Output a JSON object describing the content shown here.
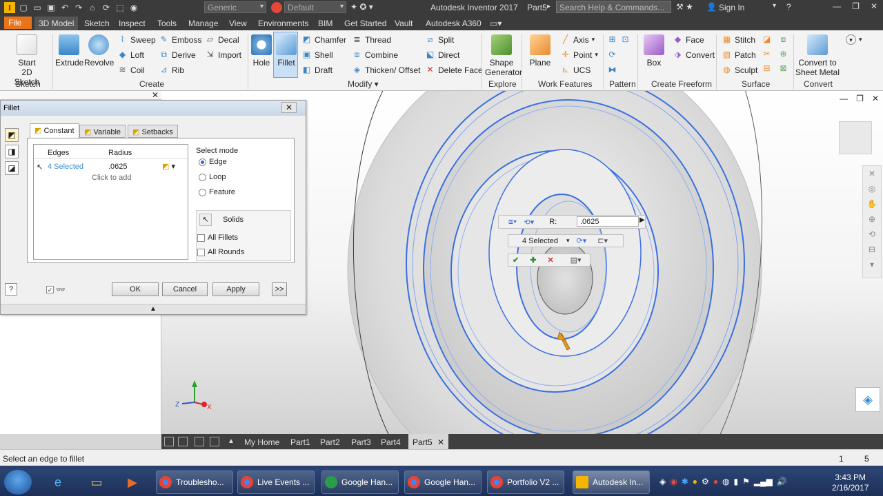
{
  "titlebar": {
    "style_combo": "Generic",
    "appearance_combo": "Default",
    "app_title": "Autodesk Inventor 2017",
    "doc_title": "Part5",
    "search_placeholder": "Search Help & Commands...",
    "sign_in": "Sign In"
  },
  "menu": {
    "file": "File",
    "tabs": [
      "3D Model",
      "Sketch",
      "Inspect",
      "Tools",
      "Manage",
      "View",
      "Environments",
      "BIM",
      "Get Started",
      "Vault",
      "Autodesk A360"
    ]
  },
  "ribbon": {
    "sketch": {
      "start_sketch": "Start",
      "start_sketch_2": "2D Sketch",
      "group": "Sketch"
    },
    "create": {
      "extrude": "Extrude",
      "revolve": "Revolve",
      "sweep": "Sweep",
      "loft": "Loft",
      "coil": "Coil",
      "emboss": "Emboss",
      "derive": "Derive",
      "rib": "Rib",
      "decal": "Decal",
      "import": "Import",
      "group": "Create"
    },
    "modify": {
      "hole": "Hole",
      "fillet": "Fillet",
      "chamfer": "Chamfer",
      "shell": "Shell",
      "draft": "Draft",
      "thread": "Thread",
      "combine": "Combine",
      "thicken": "Thicken/ Offset",
      "split": "Split",
      "direct": "Direct",
      "delete_face": "Delete Face",
      "group": "Modify"
    },
    "explore": {
      "shape_generator": "Shape",
      "shape_generator_2": "Generator",
      "group": "Explore"
    },
    "work_features": {
      "plane": "Plane",
      "axis": "Axis",
      "point": "Point",
      "ucs": "UCS",
      "group": "Work Features"
    },
    "pattern": {
      "group": "Pattern"
    },
    "freeform": {
      "box": "Box",
      "face": "Face",
      "convert": "Convert",
      "group": "Create Freeform"
    },
    "surface": {
      "stitch": "Stitch",
      "patch": "Patch",
      "sculpt": "Sculpt",
      "group": "Surface"
    },
    "convert": {
      "convert_sheet_metal": "Convert to",
      "convert_sheet_metal_2": "Sheet Metal",
      "group": "Convert"
    }
  },
  "dialog": {
    "title": "Fillet",
    "tabs": [
      "Constant",
      "Variable",
      "Setbacks"
    ],
    "grid_headers": {
      "edges": "Edges",
      "radius": "Radius"
    },
    "row": {
      "edges": "4 Selected",
      "radius": ".0625"
    },
    "click_to_add": "Click to add",
    "select_mode_label": "Select mode",
    "modes": [
      "Edge",
      "Loop",
      "Feature"
    ],
    "selected_mode": "Edge",
    "solids_label": "Solids",
    "all_fillets": "All Fillets",
    "all_rounds": "All Rounds",
    "ok": "OK",
    "cancel": "Cancel",
    "apply": "Apply",
    "more": ">>"
  },
  "minitoolbar": {
    "radius_label": "R:",
    "radius_value": ".0625",
    "selection": "4 Selected"
  },
  "doc_tabs": [
    "My Home",
    "Part1",
    "Part2",
    "Part3",
    "Part4",
    "Part5"
  ],
  "active_doc": "Part5",
  "status": {
    "message": "Select an edge to fillet",
    "count1": "1",
    "count2": "5"
  },
  "taskbar": {
    "tasks": [
      "Troublesho...",
      "Live Events ...",
      "Google Han...",
      "Google Han...",
      "Portfolio V2 ...",
      "Autodesk In..."
    ],
    "time": "3:43 PM",
    "date": "2/16/2017"
  },
  "colors": {
    "accent_orange": "#e8731a",
    "selection_blue": "#3a6fe0",
    "title_dark": "#3b3b3b",
    "taskbar_blue": "#2c4574"
  }
}
